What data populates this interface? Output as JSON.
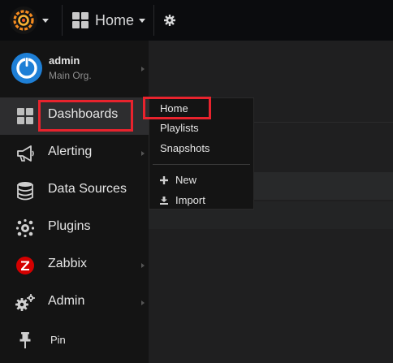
{
  "topbar": {
    "dashboard_title": "Home",
    "icons": [
      "grafana-logo-icon",
      "dashboard-grid-icon",
      "settings-gear-icon"
    ]
  },
  "user": {
    "name": "admin",
    "org": "Main Org."
  },
  "sidemenu": {
    "items": [
      {
        "label": "Dashboards",
        "icon": "dashboard-grid-icon",
        "active": true
      },
      {
        "label": "Alerting",
        "icon": "megaphone-icon"
      },
      {
        "label": "Data Sources",
        "icon": "database-icon"
      },
      {
        "label": "Plugins",
        "icon": "plug-icon"
      },
      {
        "label": "Zabbix",
        "icon": "zabbix-logo-icon"
      },
      {
        "label": "Admin",
        "icon": "cogs-icon"
      },
      {
        "label": "Pin",
        "icon": "pin-icon"
      }
    ]
  },
  "dashboards_menu": {
    "items": [
      {
        "label": "Home"
      },
      {
        "label": "Playlists"
      },
      {
        "label": "Snapshots"
      }
    ],
    "actions": [
      {
        "label": "New",
        "icon": "plus-icon"
      },
      {
        "label": "Import",
        "icon": "download-icon"
      }
    ]
  },
  "colors": {
    "highlight": "#e8232d",
    "grafana_orange": "#f58b1f",
    "avatar_blue": "#1e7fd6",
    "zabbix_red": "#d40000"
  }
}
